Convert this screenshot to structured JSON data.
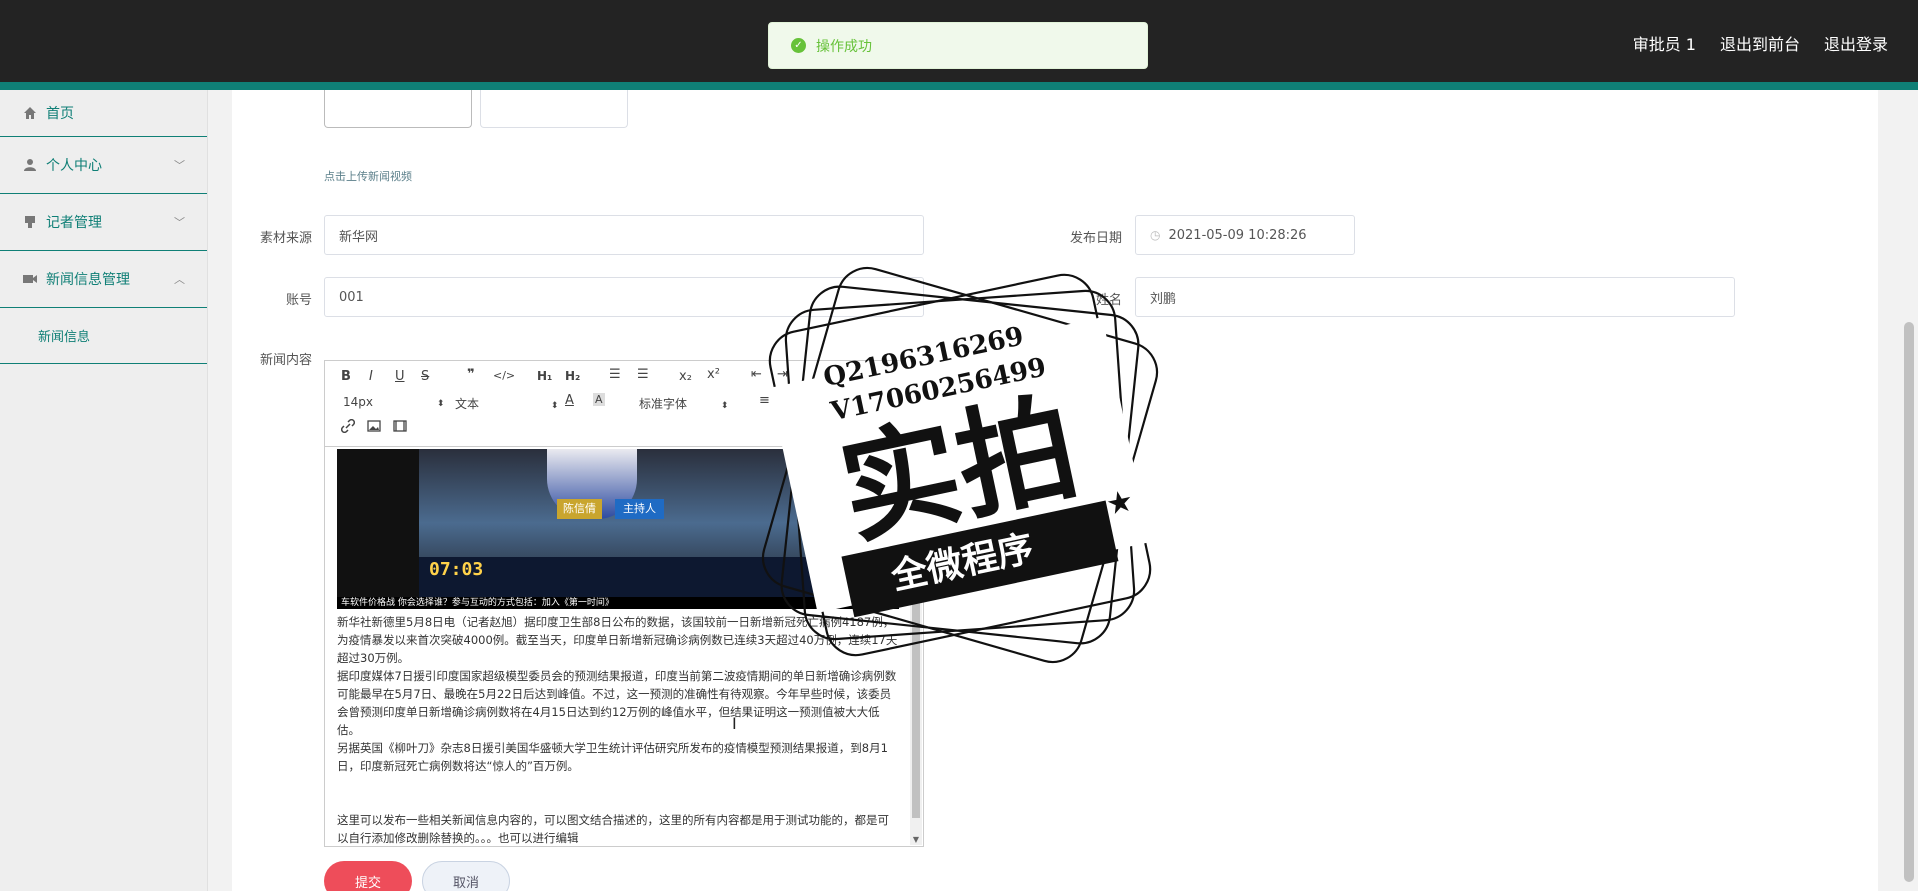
{
  "header": {
    "user": "审批员 1",
    "to_front": "退出到前台",
    "logout": "退出登录"
  },
  "toast": {
    "message": "操作成功"
  },
  "sidebar": {
    "items": [
      {
        "label": "首页",
        "icon": "home-icon"
      },
      {
        "label": "个人中心",
        "icon": "user-icon"
      },
      {
        "label": "记者管理",
        "icon": "reporter-icon"
      },
      {
        "label": "新闻信息管理",
        "icon": "news-icon"
      }
    ],
    "sub_item": "新闻信息"
  },
  "form": {
    "upload_hint": "点击上传新闻视频",
    "source_label": "素材来源",
    "source_value": "新华网",
    "date_label": "发布日期",
    "date_value": "2021-05-09 10:28:26",
    "account_label": "账号",
    "account_value": "001",
    "name_label": "姓名",
    "name_value": "刘鹏",
    "content_label": "新闻内容"
  },
  "editor": {
    "font_size": "14px",
    "block_type": "文本",
    "font_family": "标准字体",
    "video": {
      "tag_name": "陈信倩",
      "tag_role": "主持人",
      "time": "07:03",
      "crawl": "车软件价格战 你会选择谁？参与互动的方式包括：加入《第一时间》"
    },
    "paragraphs": [
      "新华社新德里5月8日电（记者赵旭）据印度卫生部8日公布的数据，该国较前一日新增新冠死亡病例4187例，为疫情暴发以来首次突破4000例。截至当天，印度单日新增新冠确诊病例数已连续3天超过40万例，连续17天超过30万例。",
      "据印度媒体7日援引印度国家超级模型委员会的预测结果报道，印度当前第二波疫情期间的单日新增确诊病例数可能最早在5月7日、最晚在5月22日后达到峰值。不过，这一预测的准确性有待观察。今年早些时候，该委员会曾预测印度单日新增确诊病例数将在4月15日达到约12万例的峰值水平，但结果证明这一预测值被大大低估。",
      "另据英国《柳叶刀》杂志8日援引美国华盛顿大学卫生统计评估研究所发布的疫情模型预测结果报道，到8月1日，印度新冠死亡病例数将达“惊人的”百万例。",
      "这里可以发布一些相关新闻信息内容的，可以图文结合描述的，这里的所有内容都是用于测试功能的，都是可以自行添加修改删除替换的。。。也可以进行编辑"
    ]
  },
  "buttons": {
    "submit": "提交",
    "cancel": "取消"
  },
  "watermark": {
    "line1": "Q2196316269",
    "line2": "V17060256499",
    "big": "实拍",
    "banner": "全微程序"
  },
  "colors": {
    "primary": "#0f7f76",
    "header": "#232323",
    "danger": "#ee4d5a",
    "success": "#67c23a"
  }
}
